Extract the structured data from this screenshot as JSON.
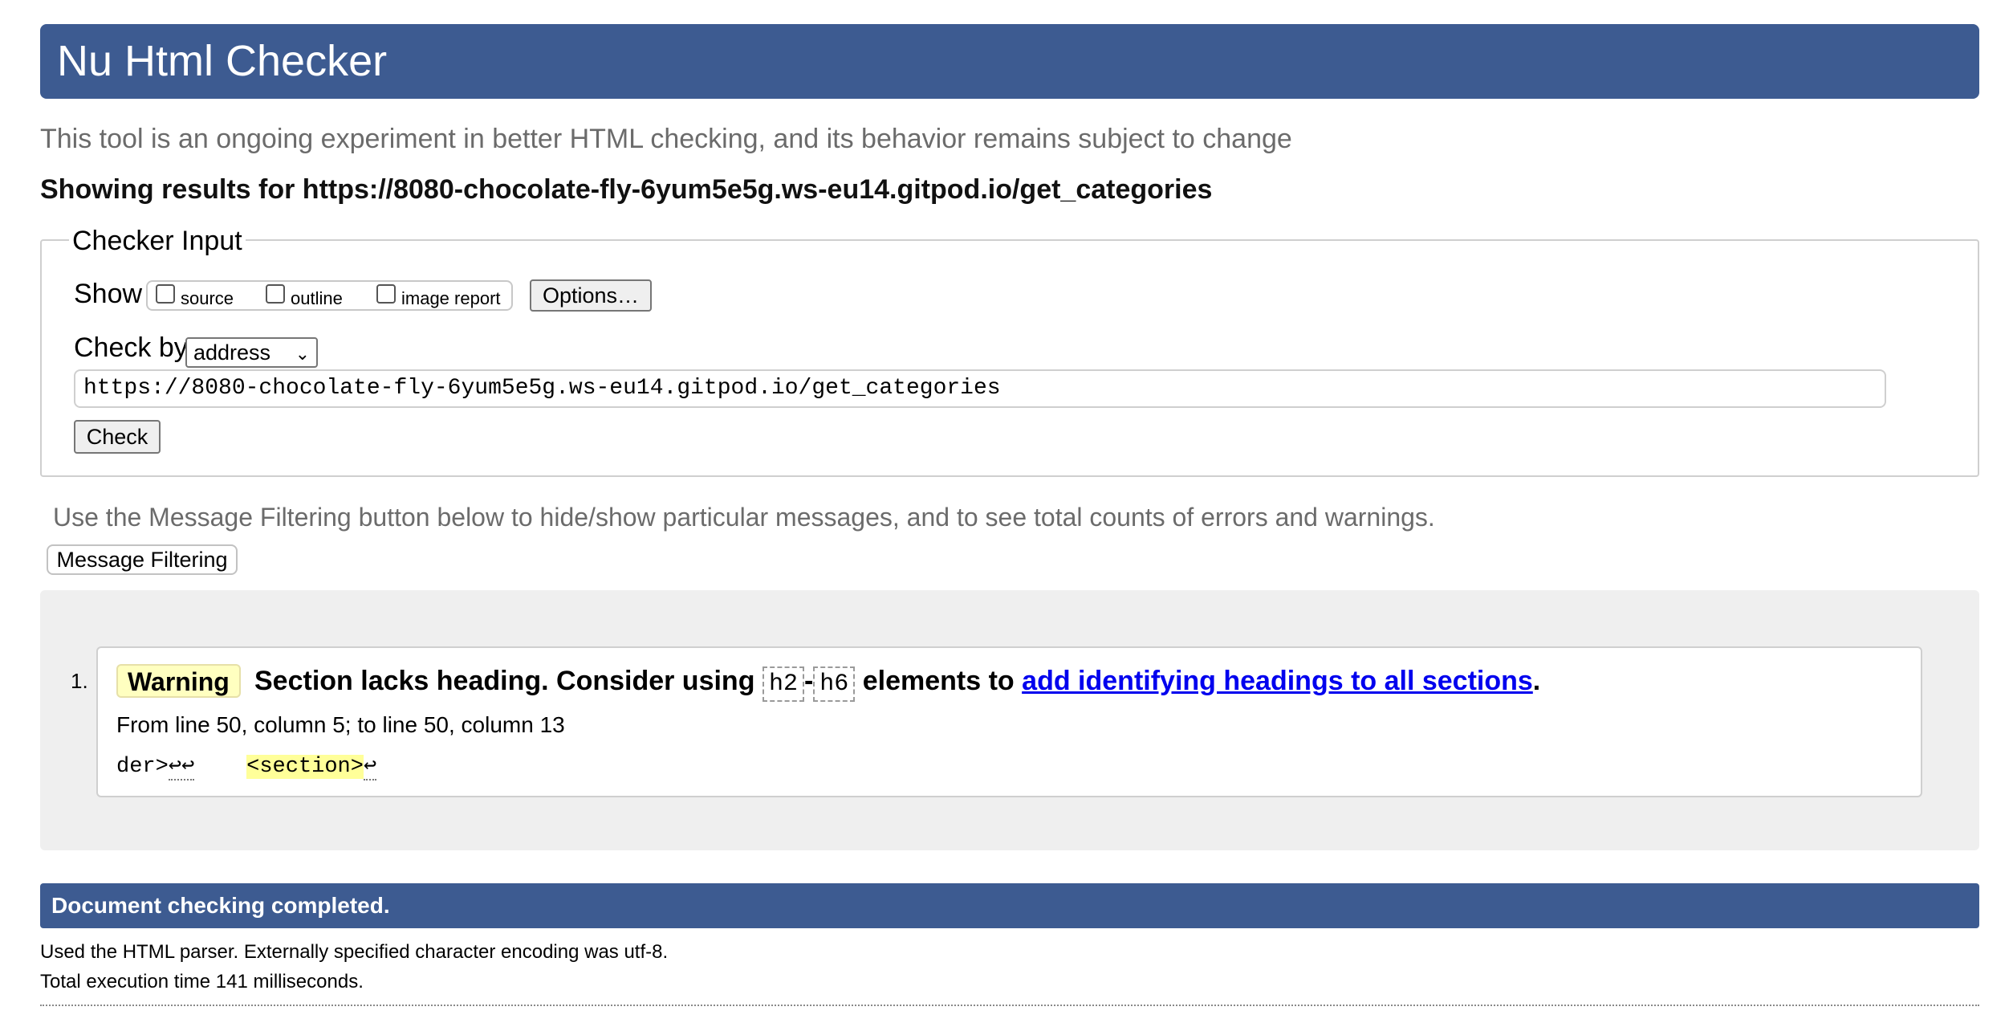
{
  "header": {
    "title": "Nu Html Checker"
  },
  "subtitle": "This tool is an ongoing experiment in better HTML checking, and its behavior remains subject to change",
  "showing": "Showing results for https://8080-chocolate-fly-6yum5e5g.ws-eu14.gitpod.io/get_categories",
  "checker_input": {
    "legend": "Checker Input",
    "show_label": "Show",
    "show_options": [
      {
        "label": "source",
        "checked": false
      },
      {
        "label": "outline",
        "checked": false
      },
      {
        "label": "image report",
        "checked": false
      }
    ],
    "options_button": "Options…",
    "check_by_label": "Check by",
    "check_by_value": "address",
    "url_value": "https://8080-chocolate-fly-6yum5e5g.ws-eu14.gitpod.io/get_categories",
    "check_button": "Check"
  },
  "filter_hint": "Use the Message Filtering button below to hide/show particular messages, and to see total counts of errors and warnings.",
  "filter_button": "Message Filtering",
  "messages": [
    {
      "ordinal": "1.",
      "type": "Warning",
      "text_before": "Section lacks heading. Consider using",
      "code_a": "h2",
      "dash": "-",
      "code_b": "h6",
      "text_middle": "elements to",
      "link_text": "add identifying headings to all sections",
      "text_after": ".",
      "location": "From line 50, column 5; to line 50, column 13",
      "extract_pre": "der>",
      "extract_marks": "↩↩",
      "extract_gap": "    ",
      "extract_highlight": "<section>",
      "extract_post": "↩"
    }
  ],
  "completion": {
    "title": "Document checking completed.",
    "parser_info": "Used the HTML parser. Externally specified character encoding was utf-8.",
    "time_info": "Total execution time 141 milliseconds."
  },
  "colors": {
    "header_bg": "#3d5b91",
    "warning_bg": "#ffffc0",
    "highlight": "#ffff99",
    "link": "#0000ee"
  }
}
